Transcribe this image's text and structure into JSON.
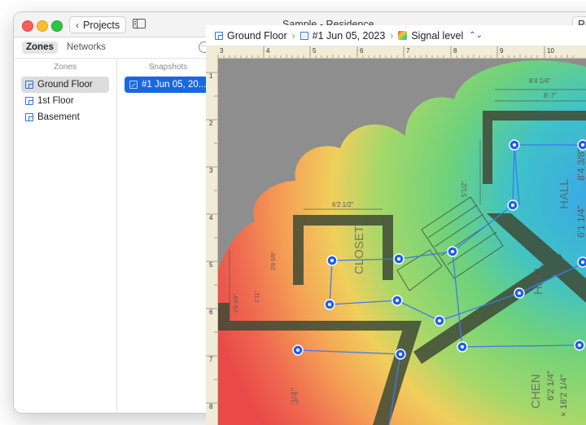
{
  "window": {
    "title": "Sample - Residence",
    "back_label": "Projects",
    "right_button_label": "Re"
  },
  "panel": {
    "tabs": [
      {
        "label": "Zones",
        "active": true
      },
      {
        "label": "Networks",
        "active": false
      }
    ],
    "zones_header": "Zones",
    "snapshots_header": "Snapshots",
    "zones": [
      {
        "label": "Ground Floor",
        "selected": true
      },
      {
        "label": "1st Floor",
        "selected": false
      },
      {
        "label": "Basement",
        "selected": false
      }
    ],
    "snapshots": [
      {
        "label": "#1 Jun 05, 20...",
        "selected": true
      }
    ]
  },
  "breadcrumb": {
    "floor": "Ground Floor",
    "snapshot": "#1 Jun 05, 2023",
    "view": "Signal level"
  },
  "ruler": {
    "top_ticks": [
      "3",
      "4",
      "5",
      "6",
      "7",
      "8",
      "9",
      "10"
    ],
    "left_ticks": [
      "1",
      "2",
      "3",
      "4",
      "5",
      "6",
      "7",
      "8"
    ]
  },
  "plan_labels": {
    "closet": "CLOSET",
    "hall_1": "HALL",
    "hall_2": "HALL",
    "kitchen": "CHEN",
    "dim_top": "8'4 1/4\"",
    "dim_top2": "8'-7\"",
    "dim_closet": "6'2 1/2\"",
    "dim_stairs": "5'1/2\"",
    "dim_hall": "8'4 3/8\"",
    "dim_hall2": "6'1 1/4\"",
    "dim_kitchen": "6'2 1/4\"",
    "dim_left": "2'8 5/8\"",
    "dim_left2": "1'11\"",
    "dim_left3": "2'8 3/4\"",
    "dim_bottom": "3/4\"",
    "kitchen_dim2": "× 16'2 1/4\""
  },
  "colors": {
    "selection_blue": "#1a67e0",
    "survey_point": "#1f5ff0",
    "wall": "#3f4a35"
  },
  "icons": [
    "chevron-left-icon",
    "sidebar-icon",
    "more-icon",
    "floor-plan-icon",
    "snapshot-icon",
    "signal-level-icon",
    "up-down-chevron-icon"
  ]
}
